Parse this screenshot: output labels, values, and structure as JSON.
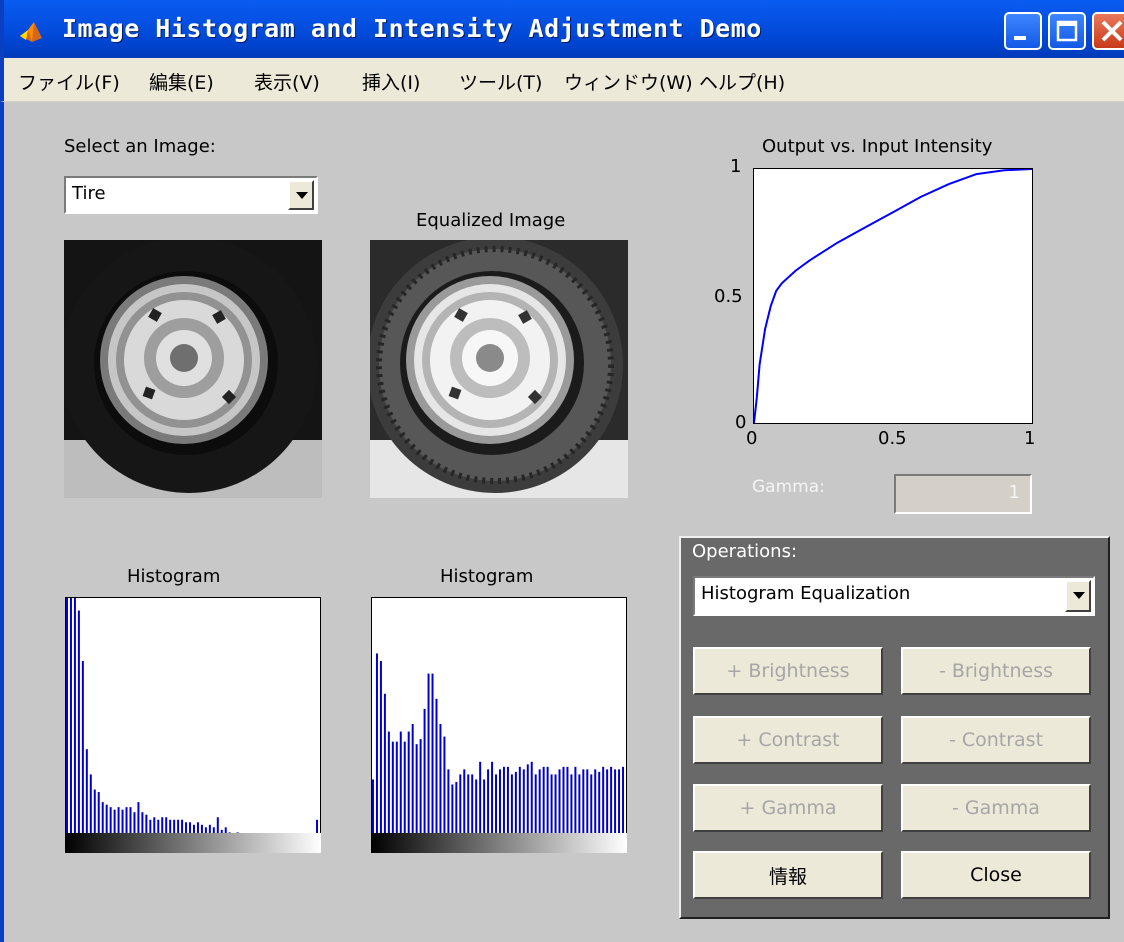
{
  "window": {
    "title": "Image Histogram and Intensity Adjustment Demo"
  },
  "menu": [
    "ファイル(F)",
    "編集(E)",
    "表示(V)",
    "挿入(I)",
    "ツール(T)",
    "ウィンドウ(W)",
    "ヘルプ(H)"
  ],
  "image_select": {
    "label": "Select an Image:",
    "value": "Tire"
  },
  "equalized_title": "Equalized Image",
  "histogram_left_title": "Histogram",
  "histogram_right_title": "Histogram",
  "plot": {
    "title": "Output vs. Input Intensity",
    "y_ticks": [
      "1",
      "0.5",
      "0"
    ],
    "x_ticks": [
      "0",
      "0.5",
      "1"
    ]
  },
  "gamma": {
    "label": "Gamma:",
    "value": "1"
  },
  "operations": {
    "title": "Operations:",
    "selected": "Histogram Equalization",
    "buttons": {
      "plus_brightness": "+ Brightness",
      "minus_brightness": "- Brightness",
      "plus_contrast": "+ Contrast",
      "minus_contrast": "- Contrast",
      "plus_gamma": "+ Gamma",
      "minus_gamma": "- Gamma",
      "info": "情報",
      "close": "Close"
    }
  },
  "colors": {
    "curve": "#0000ff",
    "hist_bars": "#0000cc"
  },
  "chart_data": [
    {
      "type": "line",
      "title": "Output vs. Input Intensity",
      "xlim": [
        0,
        1
      ],
      "ylim": [
        0,
        1
      ],
      "x": [
        0,
        0.01,
        0.02,
        0.04,
        0.06,
        0.08,
        0.1,
        0.15,
        0.2,
        0.3,
        0.4,
        0.5,
        0.6,
        0.7,
        0.8,
        0.9,
        1.0
      ],
      "y": [
        0,
        0.1,
        0.23,
        0.37,
        0.46,
        0.52,
        0.55,
        0.6,
        0.64,
        0.71,
        0.77,
        0.83,
        0.89,
        0.94,
        0.98,
        0.995,
        1.0
      ]
    },
    {
      "type": "bar",
      "title": "Histogram",
      "ylim": [
        0,
        1
      ],
      "values": [
        1,
        1,
        1,
        0.95,
        0.75,
        0.4,
        0.3,
        0.24,
        0.23,
        0.19,
        0.18,
        0.17,
        0.16,
        0.17,
        0.16,
        0.17,
        0.17,
        0.15,
        0.19,
        0.15,
        0.14,
        0.12,
        0.13,
        0.12,
        0.13,
        0.13,
        0.12,
        0.12,
        0.12,
        0.12,
        0.11,
        0.11,
        0.1,
        0.11,
        0.1,
        0.09,
        0.1,
        0.09,
        0.13,
        0.08,
        0.09,
        0.07,
        0.06,
        0.07,
        0.05,
        0.06,
        0.05,
        0.05,
        0.05,
        0.05,
        0.05,
        0.04,
        0.05,
        0.04,
        0.04,
        0.04,
        0.04,
        0.03,
        0.03,
        0.03,
        0.03,
        0.04,
        0.04,
        0.12
      ]
    },
    {
      "type": "bar",
      "title": "Histogram",
      "ylim": [
        0,
        1
      ],
      "values": [
        0.28,
        0.78,
        0.75,
        0.62,
        0.47,
        0.43,
        0.43,
        0.47,
        0.43,
        0.47,
        0.5,
        0.42,
        0.44,
        0.56,
        0.7,
        0.7,
        0.6,
        0.5,
        0.45,
        0.32,
        0.26,
        0.27,
        0.3,
        0.32,
        0.3,
        0.3,
        0.28,
        0.35,
        0.28,
        0.32,
        0.35,
        0.3,
        0.32,
        0.33,
        0.33,
        0.3,
        0.31,
        0.33,
        0.32,
        0.34,
        0.35,
        0.3,
        0.32,
        0.33,
        0.33,
        0.3,
        0.3,
        0.32,
        0.33,
        0.33,
        0.3,
        0.33,
        0.3,
        0.32,
        0.32,
        0.3,
        0.32,
        0.31,
        0.33,
        0.32,
        0.33,
        0.32,
        0.32,
        0.33
      ]
    }
  ]
}
